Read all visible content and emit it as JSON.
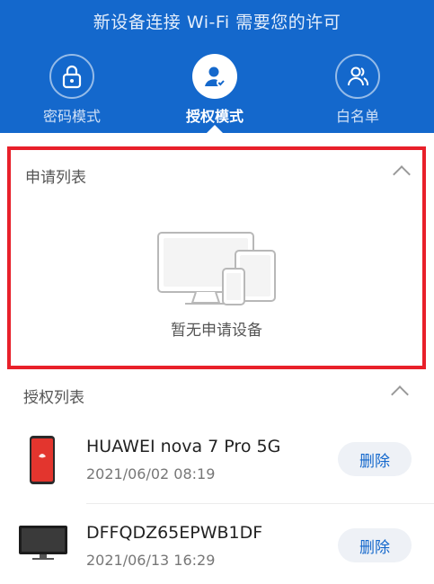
{
  "header": {
    "title": "新设备连接 Wi-Fi 需要您的许可",
    "bg_color": "#1468CC",
    "tabs": [
      {
        "label": "密码模式",
        "icon": "lock-icon",
        "active": false
      },
      {
        "label": "授权模式",
        "icon": "user-check-icon",
        "active": true
      },
      {
        "label": "白名单",
        "icon": "users-icon",
        "active": false
      }
    ]
  },
  "apply_list": {
    "title": "申请列表",
    "empty_text": "暂无申请设备",
    "highlight_color": "#E8202A"
  },
  "auth_list": {
    "title": "授权列表",
    "devices": [
      {
        "name": "HUAWEI nova 7 Pro 5G",
        "time": "2021/06/02 08:19",
        "delete_label": "删除",
        "icon": "phone-icon"
      },
      {
        "name": "DFFQDZ65EPWB1DF",
        "time": "2021/06/13 16:29",
        "delete_label": "删除",
        "icon": "monitor-icon"
      }
    ]
  }
}
